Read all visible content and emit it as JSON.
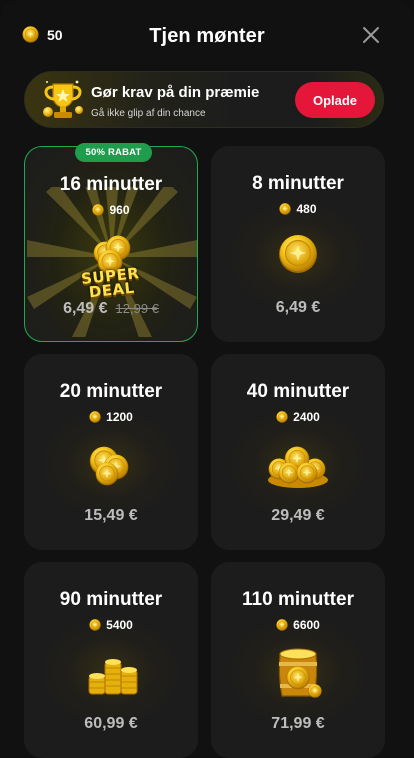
{
  "header": {
    "balance": "50",
    "title": "Tjen mønter"
  },
  "banner": {
    "title": "Gør krav på din præmie",
    "subtitle": "Gå ikke glip af din chance",
    "button_label": "Oplade"
  },
  "offers": [
    {
      "title": "16 minutter",
      "coins": "960",
      "price": "6,49 €",
      "old_price": "12,99 €",
      "badge": "50% RABAT",
      "art_text": [
        "SUPER",
        "DEAL"
      ]
    },
    {
      "title": "8 minutter",
      "coins": "480",
      "price": "6,49 €"
    },
    {
      "title": "20 minutter",
      "coins": "1200",
      "price": "15,49 €"
    },
    {
      "title": "40 minutter",
      "coins": "2400",
      "price": "29,49 €"
    },
    {
      "title": "90 minutter",
      "coins": "5400",
      "price": "60,99 €"
    },
    {
      "title": "110 minutter",
      "coins": "6600",
      "price": "71,99 €"
    }
  ],
  "colors": {
    "accent_red": "#e4163a",
    "discount_green": "#1f9d4d",
    "coin_gold": "#f5c518",
    "card_bg": "#1c1c1c"
  },
  "icons": {
    "balance": "coin-icon",
    "close": "close-icon",
    "banner": "trophy-icon"
  }
}
